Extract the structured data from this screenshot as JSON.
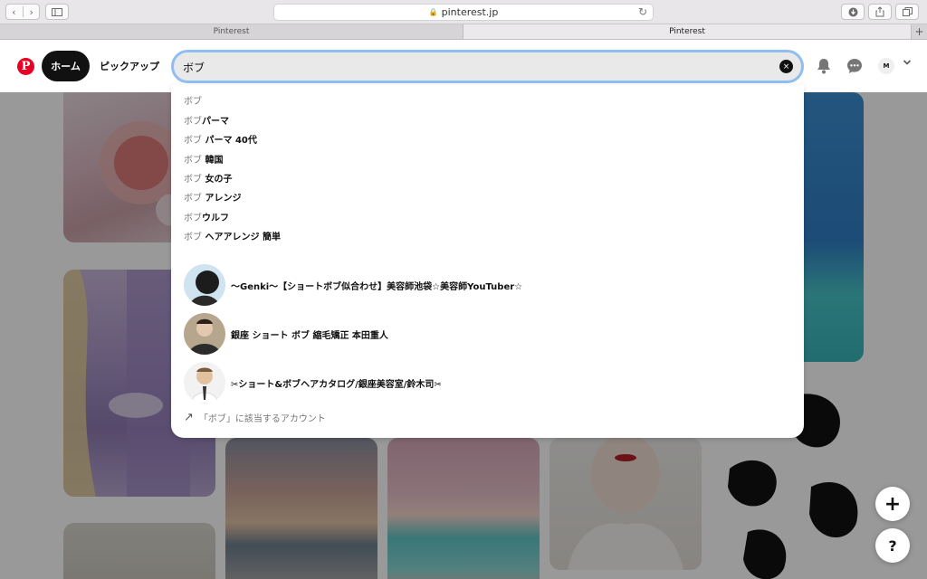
{
  "browser": {
    "url": "pinterest.jp",
    "tabs": [
      {
        "label": "Pinterest",
        "active": false
      },
      {
        "label": "Pinterest",
        "active": true
      }
    ]
  },
  "header": {
    "logo": "P",
    "home_label": "ホーム",
    "pickup_label": "ピックアップ",
    "avatar_initial": "M"
  },
  "search": {
    "value": "ボブ",
    "clear_icon": "×"
  },
  "suggestions": [
    {
      "query": "ボブ",
      "rest": ""
    },
    {
      "query": "ボブ",
      "rest": "パーマ"
    },
    {
      "query": "ボブ",
      "rest": " パーマ 40代"
    },
    {
      "query": "ボブ",
      "rest": " 韓国"
    },
    {
      "query": "ボブ",
      "rest": " 女の子"
    },
    {
      "query": "ボブ",
      "rest": " アレンジ"
    },
    {
      "query": "ボブ",
      "rest": "ウルフ"
    },
    {
      "query": "ボブ",
      "rest": " ヘアアレンジ 簡単"
    }
  ],
  "accounts": [
    {
      "name": "〜Genki〜【ショートボブ似合わせ】美容師池袋☆美容師YouTuber☆"
    },
    {
      "name": "銀座 ショート ボブ 縮毛矯正 本田重人"
    },
    {
      "name": "✂︎ショート&ボブヘアカタログ/銀座美容室/鈴木司✂︎"
    }
  ],
  "more_accounts_label": "「ボブ」に該当するアカウント",
  "fab": {
    "add_label": "+",
    "help_label": "?"
  },
  "colors": {
    "brand": "#e60023",
    "focus_ring": "#8fbef0"
  }
}
